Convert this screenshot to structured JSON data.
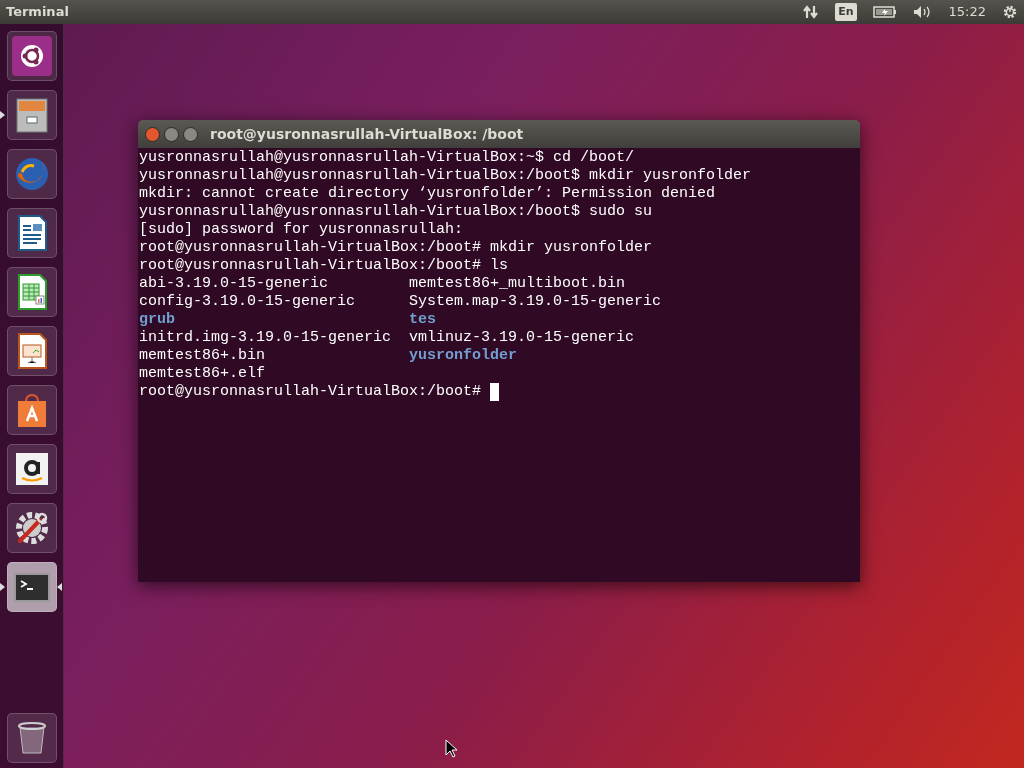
{
  "top_bar": {
    "app_title": "Terminal",
    "keyboard_layout": "En",
    "clock": "15:22"
  },
  "launcher": {
    "items": [
      {
        "kind": "dash",
        "running": false,
        "focused": false
      },
      {
        "kind": "files",
        "running": true,
        "focused": false
      },
      {
        "kind": "browser",
        "running": false,
        "focused": false
      },
      {
        "kind": "writer",
        "running": false,
        "focused": false
      },
      {
        "kind": "calc",
        "running": false,
        "focused": false
      },
      {
        "kind": "impress",
        "running": false,
        "focused": false
      },
      {
        "kind": "store",
        "running": false,
        "focused": false
      },
      {
        "kind": "amazon",
        "running": false,
        "focused": false
      },
      {
        "kind": "settings",
        "running": false,
        "focused": false
      },
      {
        "kind": "terminal",
        "running": true,
        "focused": true
      }
    ],
    "trash": {
      "kind": "trash"
    }
  },
  "terminal": {
    "title": "root@yusronnasrullah-VirtualBox: /boot",
    "lines": [
      {
        "kind": "text",
        "text": "yusronnasrullah@yusronnasrullah-VirtualBox:~$ cd /boot/"
      },
      {
        "kind": "text",
        "text": "yusronnasrullah@yusronnasrullah-VirtualBox:/boot$ mkdir yusronfolder"
      },
      {
        "kind": "text",
        "text": "mkdir: cannot create directory ‘yusronfolder’: Permission denied"
      },
      {
        "kind": "text",
        "text": "yusronnasrullah@yusronnasrullah-VirtualBox:/boot$ sudo su"
      },
      {
        "kind": "text",
        "text": "[sudo] password for yusronnasrullah:"
      },
      {
        "kind": "text",
        "text": "root@yusronnasrullah-VirtualBox:/boot# mkdir yusronfolder"
      },
      {
        "kind": "text",
        "text": "root@yusronnasrullah-VirtualBox:/boot# ls"
      },
      {
        "kind": "columns",
        "cells": [
          {
            "text": "abi-3.19.0-15-generic",
            "kind": "file"
          },
          {
            "text": "memtest86+_multiboot.bin",
            "kind": "file"
          }
        ]
      },
      {
        "kind": "columns",
        "cells": [
          {
            "text": "config-3.19.0-15-generic",
            "kind": "file"
          },
          {
            "text": "System.map-3.19.0-15-generic",
            "kind": "file"
          }
        ]
      },
      {
        "kind": "columns",
        "cells": [
          {
            "text": "grub",
            "kind": "dir"
          },
          {
            "text": "tes",
            "kind": "dir"
          }
        ]
      },
      {
        "kind": "columns",
        "cells": [
          {
            "text": "initrd.img-3.19.0-15-generic",
            "kind": "file"
          },
          {
            "text": "vmlinuz-3.19.0-15-generic",
            "kind": "file"
          }
        ]
      },
      {
        "kind": "columns",
        "cells": [
          {
            "text": "memtest86+.bin",
            "kind": "file"
          },
          {
            "text": "yusronfolder",
            "kind": "dir"
          }
        ]
      },
      {
        "kind": "columns",
        "cells": [
          {
            "text": "memtest86+.elf",
            "kind": "file"
          }
        ]
      },
      {
        "kind": "prompt",
        "text": "root@yusronnasrullah-VirtualBox:/boot# ",
        "cursor": true
      }
    ]
  }
}
